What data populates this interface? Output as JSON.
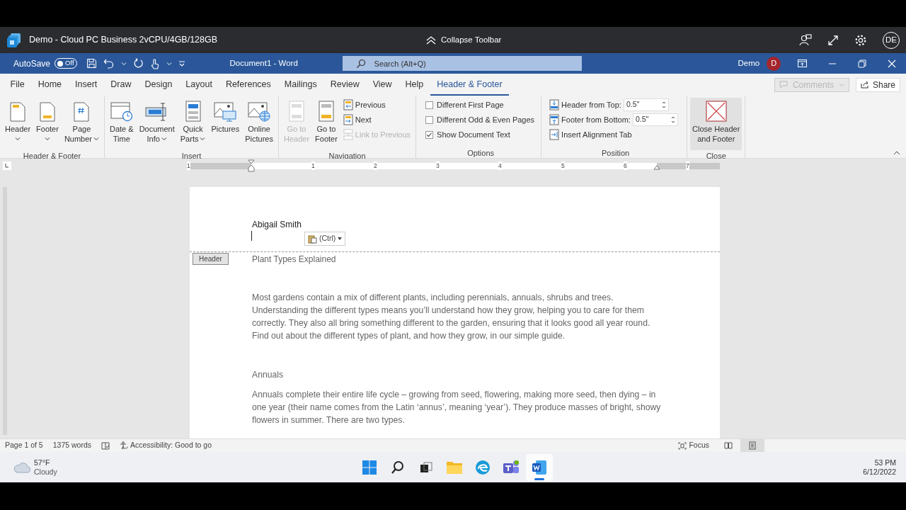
{
  "remote_bar": {
    "title": "Demo - Cloud PC Business 2vCPU/4GB/128GB",
    "collapse": "Collapse Toolbar",
    "avatar": "DE"
  },
  "title_bar": {
    "autosave_label": "AutoSave",
    "autosave": {
      "on": false,
      "label": "Off"
    },
    "document_title": "Document1  -  Word",
    "search": {
      "placeholder": "Search (Alt+Q)"
    },
    "user": "Demo",
    "user_avatar": "D"
  },
  "tabs": [
    {
      "label": "File",
      "selected": false
    },
    {
      "label": "Home",
      "selected": false
    },
    {
      "label": "Insert",
      "selected": false
    },
    {
      "label": "Draw",
      "selected": false
    },
    {
      "label": "Design",
      "selected": false
    },
    {
      "label": "Layout",
      "selected": false
    },
    {
      "label": "References",
      "selected": false
    },
    {
      "label": "Mailings",
      "selected": false
    },
    {
      "label": "Review",
      "selected": false
    },
    {
      "label": "View",
      "selected": false
    },
    {
      "label": "Help",
      "selected": false
    },
    {
      "label": "Header & Footer",
      "selected": true
    }
  ],
  "tab_actions": {
    "comments": {
      "label": "Comments",
      "disabled": true
    },
    "share": "Share"
  },
  "ribbon": {
    "groups": [
      {
        "label": "Header & Footer",
        "items": [
          {
            "kind": "large",
            "lines": [
              "Header"
            ],
            "dropdown": true,
            "disabled": false
          },
          {
            "kind": "large",
            "lines": [
              "Footer"
            ],
            "dropdown": true,
            "disabled": false
          },
          {
            "kind": "large",
            "lines": [
              "Page",
              "Number"
            ],
            "dropdown": true,
            "disabled": false
          }
        ]
      },
      {
        "label": "Insert",
        "items": [
          {
            "kind": "large",
            "lines": [
              "Date &",
              "Time"
            ],
            "dropdown": false,
            "disabled": false
          },
          {
            "kind": "large",
            "lines": [
              "Document",
              "Info"
            ],
            "dropdown": true,
            "disabled": false
          },
          {
            "kind": "large",
            "lines": [
              "Quick",
              "Parts"
            ],
            "dropdown": true,
            "disabled": false
          },
          {
            "kind": "large",
            "lines": [
              "Pictures"
            ],
            "dropdown": false,
            "disabled": false
          },
          {
            "kind": "large",
            "lines": [
              "Online",
              "Pictures"
            ],
            "dropdown": false,
            "disabled": false
          }
        ]
      },
      {
        "label": "Navigation",
        "items": [
          {
            "kind": "large",
            "lines": [
              "Go to",
              "Header"
            ],
            "dropdown": false,
            "disabled": true
          },
          {
            "kind": "large",
            "lines": [
              "Go to",
              "Footer"
            ],
            "dropdown": false,
            "disabled": false
          },
          {
            "kind": "small",
            "label": "Previous",
            "disabled": false
          },
          {
            "kind": "small",
            "label": "Next",
            "disabled": false
          },
          {
            "kind": "small",
            "label": "Link to Previous",
            "disabled": true
          }
        ]
      },
      {
        "label": "Options",
        "items": [
          {
            "kind": "checkbox",
            "label": "Different First Page",
            "checked": false
          },
          {
            "kind": "checkbox",
            "label": "Different Odd & Even Pages",
            "checked": false
          },
          {
            "kind": "checkbox",
            "label": "Show Document Text",
            "checked": true
          }
        ]
      },
      {
        "label": "Position",
        "items": [
          {
            "kind": "spinner",
            "label": "Header from Top:",
            "value": "0.5\""
          },
          {
            "kind": "spinner",
            "label": "Footer from Bottom:",
            "value": "0.5\""
          },
          {
            "kind": "small",
            "label": "Insert Alignment Tab",
            "disabled": false
          }
        ]
      },
      {
        "label": "Close",
        "items": [
          {
            "kind": "large",
            "lines": [
              "Close Header",
              "and Footer"
            ],
            "dropdown": false,
            "disabled": false,
            "highlighted": true
          }
        ]
      }
    ]
  },
  "ruler": [
    "1",
    "1",
    "2",
    "3",
    "4",
    "5",
    "6",
    "7"
  ],
  "document": {
    "header_text": "Abigail Smith",
    "paste_options": "(Ctrl)",
    "header_tag": "Header",
    "title": "Plant Types Explained",
    "paragraphs": [
      {
        "kind": "body",
        "text": "Most gardens contain a mix of different plants, including perennials, annuals, shrubs and trees. Understanding the different types means you’ll understand how they grow, helping you to care for them correctly. They also all bring something different to the garden, ensuring that it looks good all year round. Find out about the different types of plant, and how they grow, in our simple guide."
      },
      {
        "kind": "heading",
        "text": "Annuals"
      },
      {
        "kind": "body",
        "text": "Annuals complete their entire life cycle – growing from seed, flowering, making more seed, then dying – in one year (their name comes from the Latin ‘annus’, meaning ‘year’). They produce masses of bright, showy flowers in summer. There are two types."
      }
    ]
  },
  "status_bar": {
    "page": "Page 1 of 5",
    "words": "1375 words",
    "accessibility": "Accessibility: Good to go",
    "focus": "Focus",
    "views": [
      {
        "selected": false
      },
      {
        "selected": true
      }
    ]
  },
  "taskbar": {
    "temperature": "57°F",
    "weather": "Cloudy",
    "apps": [
      {
        "active": false
      },
      {
        "active": false
      },
      {
        "active": false
      },
      {
        "active": false
      },
      {
        "active": false
      },
      {
        "active": false
      },
      {
        "active": true
      }
    ],
    "time": "53 PM",
    "date": "6/12/2022"
  }
}
